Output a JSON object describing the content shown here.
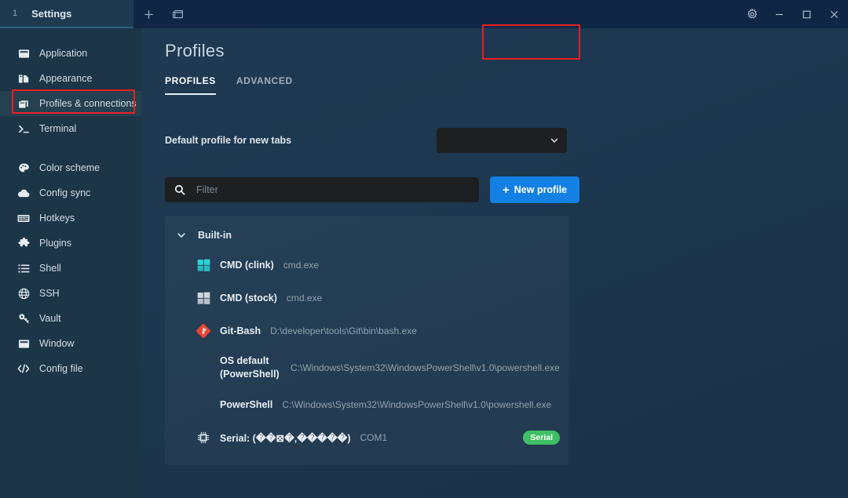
{
  "titlebar": {
    "tab_index": "1",
    "tab_title": "Settings",
    "new_tab_icon": "plus-icon",
    "split_icon": "window-split-icon",
    "settings_icon": "gear-icon",
    "minimize_icon": "minimize-icon",
    "maximize_icon": "maximize-icon",
    "close_icon": "close-icon"
  },
  "sidebar": {
    "items": [
      {
        "label": "Application",
        "icon": "window-icon",
        "active": false
      },
      {
        "label": "Appearance",
        "icon": "palette-bars-icon",
        "active": false
      },
      {
        "label": "Profiles & connections",
        "icon": "copy-icon",
        "active": true
      },
      {
        "label": "Terminal",
        "icon": "prompt-icon",
        "active": false
      },
      {
        "label": "Color scheme",
        "icon": "palette-icon",
        "active": false
      },
      {
        "label": "Config sync",
        "icon": "cloud-icon",
        "active": false
      },
      {
        "label": "Hotkeys",
        "icon": "keyboard-icon",
        "active": false
      },
      {
        "label": "Plugins",
        "icon": "puzzle-icon",
        "active": false
      },
      {
        "label": "Shell",
        "icon": "list-icon",
        "active": false
      },
      {
        "label": "SSH",
        "icon": "globe-icon",
        "active": false
      },
      {
        "label": "Vault",
        "icon": "key-icon",
        "active": false
      },
      {
        "label": "Window",
        "icon": "window-icon",
        "active": false
      },
      {
        "label": "Config file",
        "icon": "code-icon",
        "active": false
      }
    ]
  },
  "main": {
    "page_title": "Profiles",
    "tabs": [
      {
        "label": "PROFILES",
        "active": true
      },
      {
        "label": "ADVANCED",
        "active": false
      }
    ],
    "default_profile": {
      "label": "Default profile for new tabs",
      "value": "",
      "chevron_icon": "chevron-down-icon"
    },
    "filter": {
      "placeholder": "Filter",
      "value": "",
      "icon": "search-icon"
    },
    "new_profile_button": {
      "label": "New profile",
      "plus": "+"
    },
    "group": {
      "label": "Built-in",
      "expanded": true,
      "chevron_icon": "chevron-down-icon"
    },
    "profiles": [
      {
        "name": "CMD (clink)",
        "path": "cmd.exe",
        "icon": "windows-icon-cyan",
        "badge": ""
      },
      {
        "name": "CMD (stock)",
        "path": "cmd.exe",
        "icon": "windows-icon-grey",
        "badge": ""
      },
      {
        "name": "Git-Bash",
        "path": "D:\\developer\\tools\\Git\\bin\\bash.exe",
        "icon": "git-icon",
        "badge": ""
      },
      {
        "name": "OS default (PowerShell)",
        "path": "C:\\Windows\\System32\\WindowsPowerShell\\v1.0\\powershell.exe",
        "icon": "",
        "badge": ""
      },
      {
        "name": "PowerShell",
        "path": "C:\\Windows\\System32\\WindowsPowerShell\\v1.0\\powershell.exe",
        "icon": "",
        "badge": ""
      },
      {
        "name": "Serial: (��⊠�‚�����)",
        "path": "COM1",
        "icon": "chip-icon",
        "badge": "Serial"
      }
    ]
  },
  "highlights": {
    "sidebar_box_color": "#ec1c24",
    "new_profile_box_color": "#ec1c24"
  },
  "colors": {
    "accent_blue": "#1380e3",
    "badge_green": "#3fbf63",
    "sidebar_bg": "#1c3547",
    "titlebar_bg": "#0f2744"
  }
}
